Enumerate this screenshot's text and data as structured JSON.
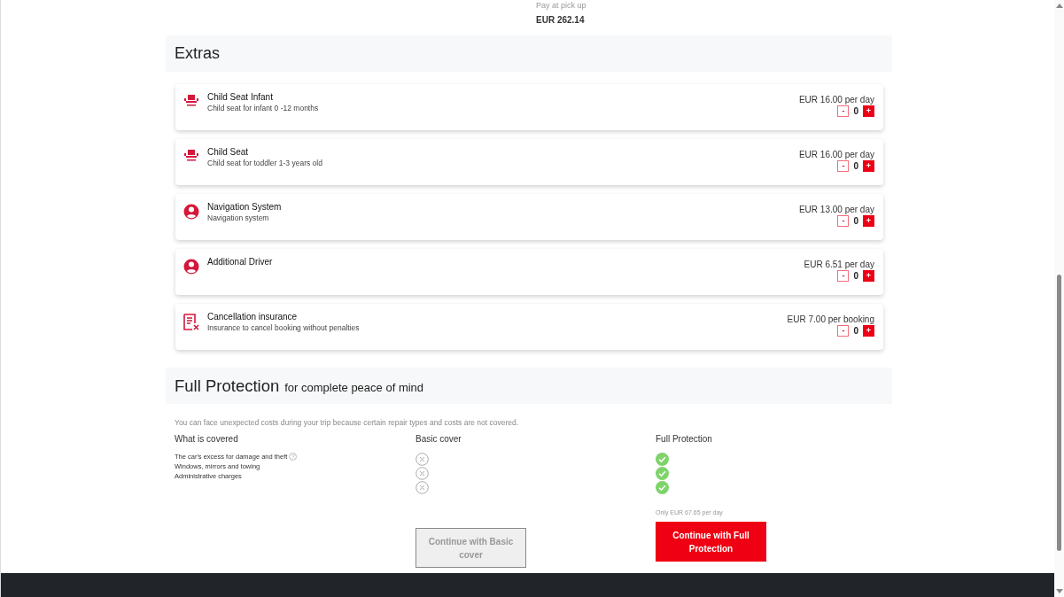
{
  "summary": {
    "note": "Pay at pick up",
    "amount": "EUR 262.14"
  },
  "extras": {
    "title": "Extras",
    "items": [
      {
        "kind": "seat",
        "name": "Child Seat Infant",
        "description": "Child seat for infant 0 -12 months",
        "price": "EUR 16.00 per day",
        "minus": "-",
        "count": "0",
        "plus": "+"
      },
      {
        "kind": "seat",
        "name": "Child Seat",
        "description": "Child seat for toddler 1-3 years old",
        "price": "EUR 16.00 per day",
        "minus": "-",
        "count": "0",
        "plus": "+"
      },
      {
        "kind": "person",
        "name": "Navigation System",
        "description": "Navigation system",
        "price": "EUR 13.00 per day",
        "minus": "-",
        "count": "0",
        "plus": "+"
      },
      {
        "kind": "person",
        "name": "Additional Driver",
        "price": "EUR 6.51 per day",
        "minus": "-",
        "count": "0",
        "plus": "+"
      },
      {
        "kind": "document",
        "name": "Cancellation insurance",
        "description": "Insurance to cancel booking without penalties",
        "price": "EUR 7.00 per booking",
        "minus": "-",
        "count": "0",
        "plus": "+"
      }
    ]
  },
  "protection": {
    "title": "Full Protection",
    "subtitle": "for complete peace of mind",
    "intro": "You can face unexpected costs during your trip because certain repair types and costs are not covered.",
    "columns": [
      "What is covered",
      "Basic cover",
      "Full Protection"
    ],
    "rows": [
      {
        "label": "The car's excess for damage and theft",
        "help": "?",
        "basic": false,
        "full": true
      },
      {
        "label": "Windows, mirrors and towing",
        "basic": false,
        "full": true
      },
      {
        "label": "Administrative charges",
        "basic": false,
        "full": true
      }
    ],
    "price_note": "Only EUR 67.65 per day",
    "basic_button": {
      "label": "Continue with Basic cover",
      "disabled": true
    },
    "full_button": {
      "label": "Continue with Full Protection",
      "disabled": false
    }
  }
}
